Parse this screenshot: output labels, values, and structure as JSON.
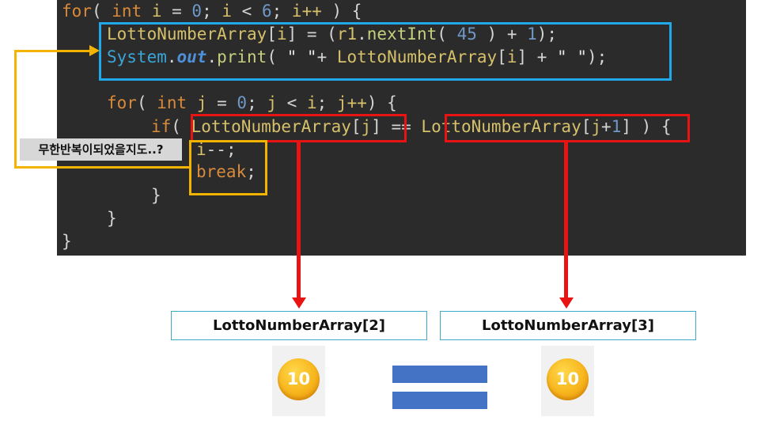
{
  "code": {
    "line1": {
      "for": "for",
      "p1": "( ",
      "int": "int",
      "p2": " ",
      "i": "i",
      "p3": " = ",
      "zero": "0",
      "p4": "; ",
      "i2": "i",
      "p5": " < ",
      "six": "6",
      "p6": "; ",
      "i3": "i++",
      "p7": " ) {"
    },
    "line2": {
      "arr": "LottoNumberArray",
      "p1": "[",
      "i": "i",
      "p2": "] = (",
      "r1": "r1",
      "p3": ".",
      "fn": "nextInt",
      "p4": "( ",
      "n45": "45",
      "p5": " ) + ",
      "one": "1",
      "p6": ");"
    },
    "line3": {
      "cls": "System",
      "p1": ".",
      "out": "out",
      "p2": ".",
      "fn": "print",
      "p3": "( ",
      "s1": "\" \"",
      "p4": "+ ",
      "arr": "LottoNumberArray",
      "p5": "[",
      "i": "i",
      "p6": "] + ",
      "s2": "\" \"",
      "p7": ");"
    },
    "line4": {
      "for": "for",
      "p1": "( ",
      "int": "int",
      "p2": " ",
      "j": "j",
      "p3": " = ",
      "zero": "0",
      "p4": "; ",
      "j2": "j",
      "p5": " < ",
      "i": "i",
      "p6": "; ",
      "j3": "j++",
      "p7": ") {"
    },
    "line5": {
      "if": "if",
      "p1": "( ",
      "arr1": "LottoNumberArray",
      "p2": "[",
      "j": "j",
      "p3": "] == ",
      "arr2": "LottoNumberArray",
      "p4": "[",
      "j2": "j",
      "p5": "+",
      "one": "1",
      "p6": "] ) {"
    },
    "line6": {
      "i": "i",
      "p1": "--;"
    },
    "line7": {
      "brk": "break",
      "p1": ";"
    },
    "line8": "}",
    "line9": "}",
    "line10": "}"
  },
  "tooltip": "무한반복이되었을지도..?",
  "labels": {
    "left": "LottoNumberArray[2]",
    "right": "LottoNumberArray[3]"
  },
  "coins": {
    "left": "10",
    "right": "10"
  },
  "colors": {
    "code_background": "#2b2b2b",
    "highlight_blue": "#21a8e8",
    "highlight_red": "#e81414",
    "highlight_yellow": "#f2b400",
    "equals_sign": "#4472c4",
    "coin": "#f7b51c"
  }
}
